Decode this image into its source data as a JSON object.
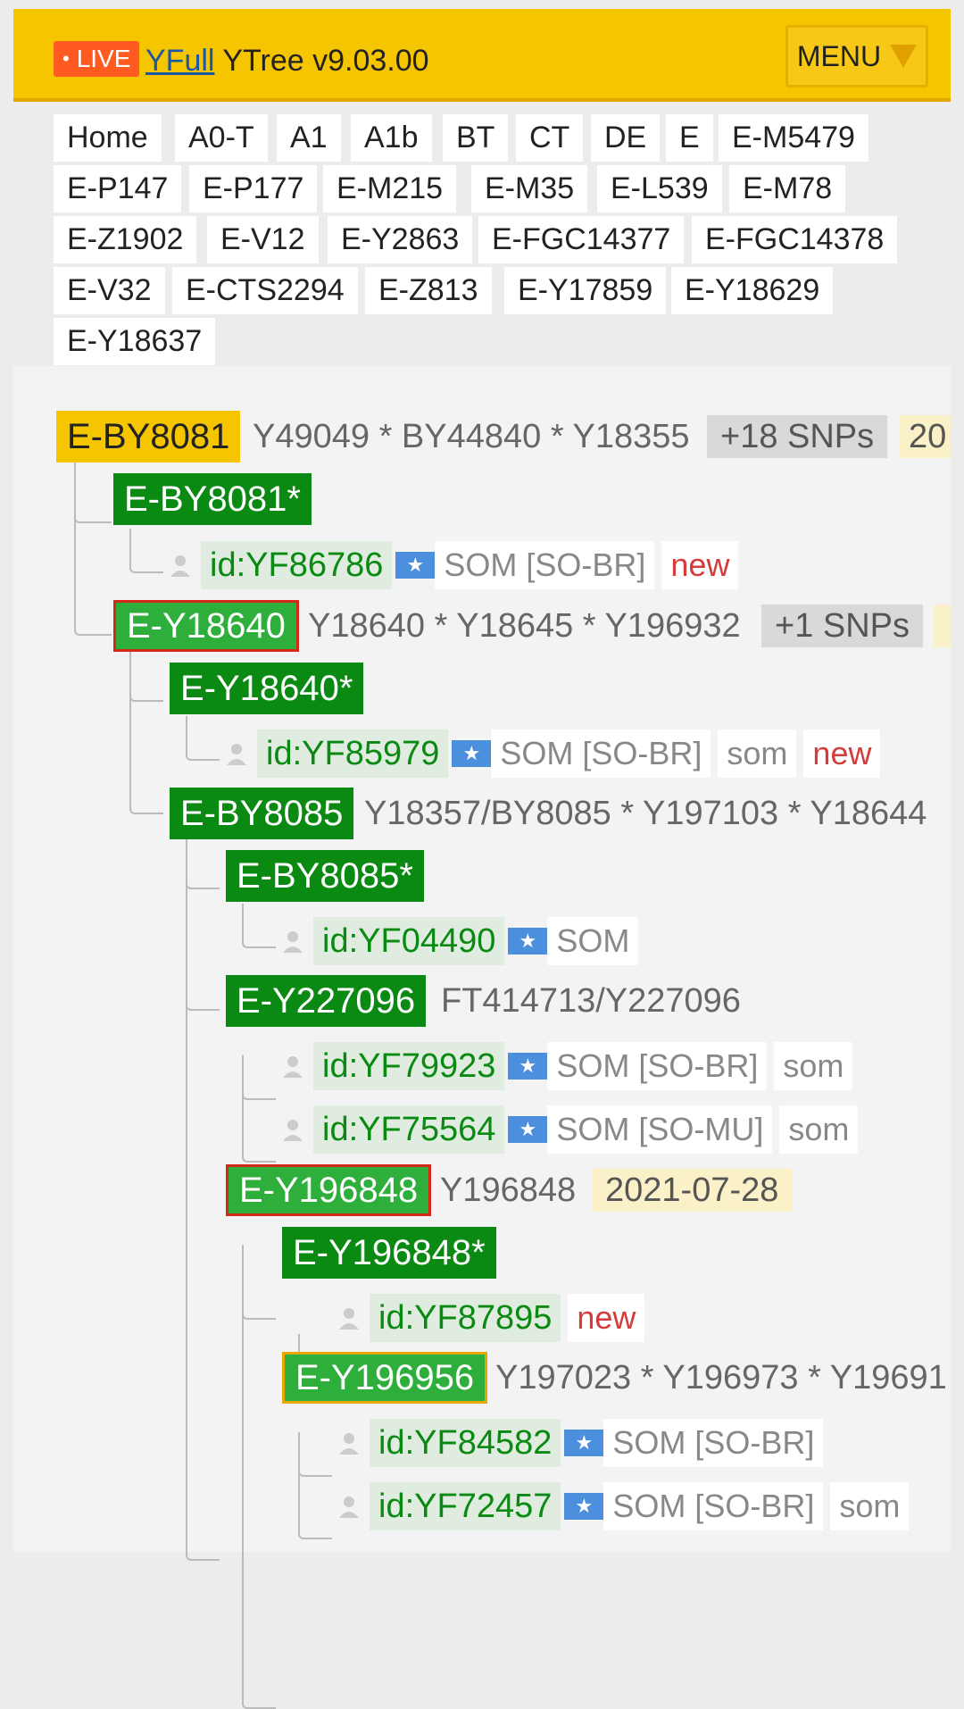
{
  "header": {
    "live_label": "LIVE",
    "brand_link": "YFull",
    "title_rest": "YTree v9.03.00",
    "menu_label": "MENU"
  },
  "nav": [
    "Home",
    "A0-T",
    "A1",
    "A1b",
    "BT",
    "CT",
    "DE",
    "E",
    "E-M5479",
    "E-P147",
    "E-P177",
    "E-M215",
    "E-M35",
    "E-L539",
    "E-M78",
    "E-Z1902",
    "E-V12",
    "E-Y2863",
    "E-FGC14377",
    "E-FGC14378",
    "E-V32",
    "E-CTS2294",
    "E-Z813",
    "E-Y17859",
    "E-Y18629",
    "E-Y18637"
  ],
  "tree": {
    "root": {
      "name": "E-BY8081",
      "snps": "Y49049 * BY44840 * Y18355",
      "snp_count": "+18 SNPs",
      "date": "20"
    },
    "n1": {
      "name": "E-BY8081*"
    },
    "s1": {
      "id": "id:YF86786",
      "country": "SOM [SO-BR]",
      "tag1": "new"
    },
    "n2": {
      "name": "E-Y18640",
      "snps": "Y18640 * Y18645 * Y196932",
      "snp_count": "+1 SNPs"
    },
    "n3": {
      "name": "E-Y18640*"
    },
    "s2": {
      "id": "id:YF85979",
      "country": "SOM [SO-BR]",
      "tag1": "som",
      "tag2": "new"
    },
    "n4": {
      "name": "E-BY8085",
      "snps": "Y18357/BY8085 * Y197103 * Y18644"
    },
    "n5": {
      "name": "E-BY8085*"
    },
    "s3": {
      "id": "id:YF04490",
      "country": "SOM"
    },
    "n6": {
      "name": "E-Y227096",
      "snps": "FT414713/Y227096"
    },
    "s4": {
      "id": "id:YF79923",
      "country": "SOM [SO-BR]",
      "tag1": "som"
    },
    "s5": {
      "id": "id:YF75564",
      "country": "SOM [SO-MU]",
      "tag1": "som"
    },
    "n7": {
      "name": "E-Y196848",
      "snps": "Y196848",
      "date": "2021-07-28"
    },
    "n8": {
      "name": "E-Y196848*"
    },
    "s6": {
      "id": "id:YF87895",
      "tag1": "new"
    },
    "n9": {
      "name": "E-Y196956",
      "snps": "Y197023 * Y196973 * Y19691"
    },
    "s7": {
      "id": "id:YF84582",
      "country": "SOM [SO-BR]"
    },
    "s8": {
      "id": "id:YF72457",
      "country": "SOM [SO-BR]",
      "tag1": "som"
    }
  },
  "icons": {
    "person": "person-icon",
    "flag": "somalia-flag-icon",
    "menu_arrow": "triangle-down-icon"
  }
}
